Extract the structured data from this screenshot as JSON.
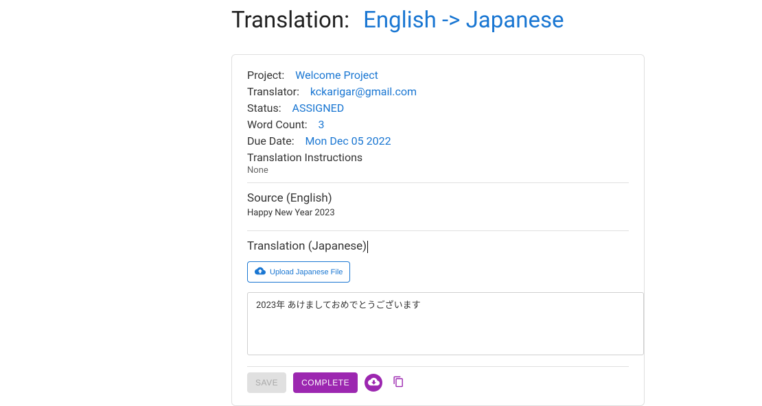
{
  "header": {
    "title": "Translation:",
    "lang_pair": "English -> Japanese"
  },
  "meta": {
    "project_label": "Project:",
    "project_value": "Welcome Project",
    "translator_label": "Translator:",
    "translator_value": "kckarigar@gmail.com",
    "status_label": "Status:",
    "status_value": "ASSIGNED",
    "word_count_label": "Word Count:",
    "word_count_value": "3",
    "due_date_label": "Due Date:",
    "due_date_value": "Mon Dec 05 2022",
    "instructions_label": "Translation Instructions",
    "instructions_value": "None"
  },
  "source": {
    "title": "Source (English)",
    "text": "Happy New Year 2023"
  },
  "translation": {
    "title": "Translation (Japanese)",
    "upload_label": "Upload Japanese File",
    "textarea_value": "2023年 あけましておめでとうございます"
  },
  "actions": {
    "save": "SAVE",
    "complete": "COMPLETE"
  },
  "icons": {
    "cloud_upload": "cloud-upload-icon",
    "cloud_download": "cloud-download-icon",
    "copy": "copy-icon"
  }
}
